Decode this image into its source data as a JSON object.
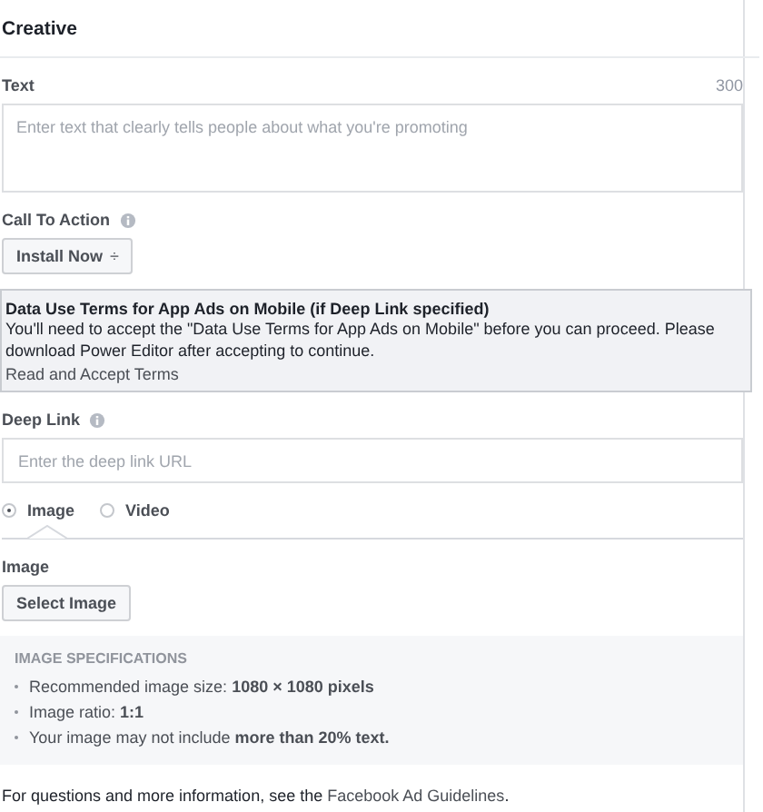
{
  "section": {
    "title": "Creative"
  },
  "text_field": {
    "label": "Text",
    "counter": "300",
    "placeholder": "Enter text that clearly tells people about what you're promoting"
  },
  "call_to_action": {
    "label": "Call To Action",
    "value": "Install Now",
    "caret": "÷"
  },
  "notice": {
    "title": "Data Use Terms for App Ads on Mobile (if Deep Link specified)",
    "body": "You'll need to accept the \"Data Use Terms for App Ads on Mobile\" before you can proceed. Please download Power Editor after accepting to continue.",
    "link": "Read and Accept Terms"
  },
  "deep_link": {
    "label": "Deep Link",
    "placeholder": "Enter the deep link URL"
  },
  "media_options": [
    {
      "label": "Image",
      "selected": true
    },
    {
      "label": "Video",
      "selected": false
    }
  ],
  "image": {
    "label": "Image",
    "button": "Select Image"
  },
  "specs": {
    "title": "IMAGE SPECIFICATIONS",
    "items": [
      {
        "text": "Recommended image size: **1080 × 1080 pixels**"
      },
      {
        "text": "Image ratio: **1:1**"
      },
      {
        "text": "Your image may not include **more than 20% text.**"
      }
    ]
  },
  "footer": {
    "text": "For questions and more information, see the",
    "link": "Facebook Ad Guidelines",
    "after": "."
  }
}
